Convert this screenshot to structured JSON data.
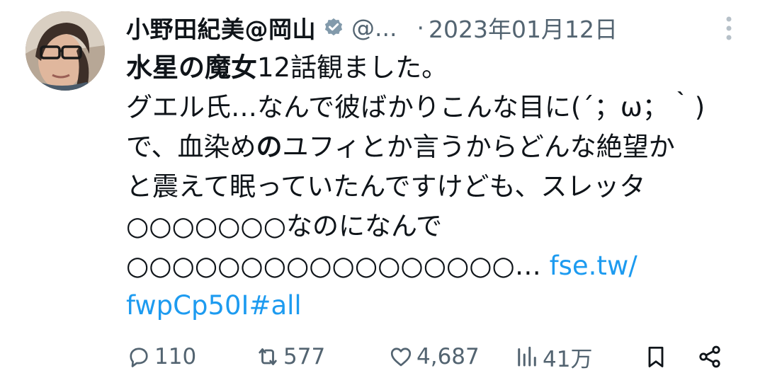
{
  "tweet": {
    "author_name": "小野田紀美@岡山",
    "handle": "@...",
    "separator": "·",
    "date": "2023年01月12日",
    "body": {
      "line1_bold": "水星の魔女",
      "line1_rest": "12話観ました。",
      "line2": "グエル氏…なんで彼ばかりこんな目に(´；ω；｀)",
      "line3_a": "で、血染め",
      "line3_bold": "の",
      "line3_b": "ユフィとか言うからどんな絶望か",
      "line4": "と震えて眠っていたんですけども、スレッタ",
      "line5": "○○○○○○○なのになんで",
      "line6_text": "○○○○○○○○○○○○○○○○○…",
      "line6_link": "fse.tw/",
      "line7_link": "fwpCp50I#all"
    },
    "stats": {
      "replies": "110",
      "retweets": "577",
      "likes": "4,687",
      "views": "41万"
    },
    "icons": {
      "verified": "verified-badge-icon",
      "more": "more-vertical-icon",
      "reply": "reply-icon",
      "retweet": "retweet-icon",
      "like": "like-icon",
      "views": "views-icon",
      "bookmark": "bookmark-icon",
      "share": "share-icon"
    },
    "colors": {
      "text": "#0f1419",
      "secondary": "#536471",
      "link": "#1d9bf0"
    }
  }
}
